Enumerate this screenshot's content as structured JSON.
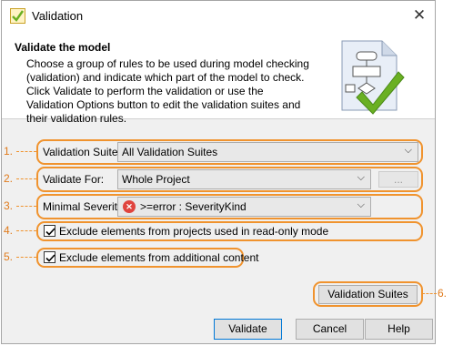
{
  "window": {
    "title": "Validation",
    "close_glyph": "✕"
  },
  "header": {
    "title": "Validate the model",
    "description": "Choose a group of rules to be used during model checking (validation) and indicate which part of the model to check. Click Validate to perform the validation or use the Validation Options button to edit the validation suites and their validation rules."
  },
  "form": {
    "suite_label": "Validation Suite:",
    "suite_value": "All Validation Suites",
    "scope_label": "Validate For:",
    "scope_value": "Whole Project",
    "scope_browse": "...",
    "severity_label": "Minimal Severity:",
    "severity_value": ">=error : SeverityKind",
    "severity_icon": "error-icon",
    "exclude_readonly_label": "Exclude elements from projects used in read-only mode",
    "exclude_readonly_checked": true,
    "exclude_additional_label": "Exclude elements from additional content",
    "exclude_additional_checked": true,
    "suites_button": "Validation Suites"
  },
  "footer": {
    "validate": "Validate",
    "cancel": "Cancel",
    "help": "Help"
  },
  "callouts": [
    "1.",
    "2.",
    "3.",
    "4.",
    "5.",
    "6."
  ],
  "colors": {
    "callout": "#f0932e",
    "accent": "#0078d7",
    "check": "#6ab023"
  }
}
